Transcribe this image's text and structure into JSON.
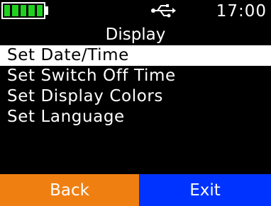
{
  "status": {
    "battery_level": 1.0,
    "usb_icon": "usb-icon",
    "time": "17:00"
  },
  "screen": {
    "title": "Display"
  },
  "menu": {
    "items": [
      {
        "label": "Set Date/Time",
        "selected": true
      },
      {
        "label": "Set Switch Off Time",
        "selected": false
      },
      {
        "label": "Set Display Colors",
        "selected": false
      },
      {
        "label": "Set Language",
        "selected": false
      }
    ]
  },
  "softkeys": {
    "back_label": "Back",
    "exit_label": "Exit"
  },
  "colors": {
    "battery": "#1fd11f",
    "back_button": "#f07f11",
    "exit_button": "#0033ff",
    "background": "#000000"
  }
}
